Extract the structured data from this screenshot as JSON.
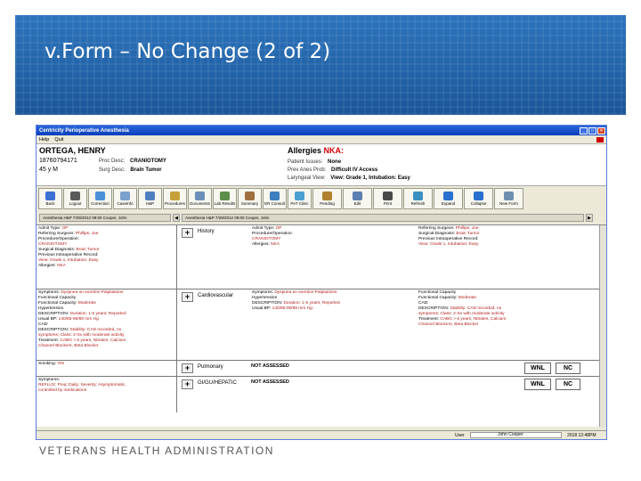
{
  "slide": {
    "title": "v.Form – No Change (2 of 2)",
    "footer": "VETERANS HEALTH ADMINISTRATION"
  },
  "app": {
    "window_title": "Centricity Perioperative Anesthesia",
    "menu": [
      "Help",
      "Quit"
    ],
    "patient": {
      "name": "ORTEGA, HENRY",
      "id": "18760794171",
      "age_sex": "45 y M",
      "proc_desc_label": "Proc Desc:",
      "proc_desc": "CRANIOTOMY",
      "surg_desc_label": "Surg Desc:",
      "surg_desc": "Brain Tumor",
      "allergies_label": "Allergies",
      "allergies_value": "NKA:",
      "patient_issues_label": "Patient Issues:",
      "patient_issues": "None",
      "prev_anes_label": "Prev Anes Prob:",
      "prev_anes": "Difficult IV Access",
      "laryngeal_label": "Laryngeal View:",
      "laryngeal": "View: Grade 1, Intubation: Easy"
    },
    "toolbar": [
      {
        "label": "Back",
        "color": "#3b6fd1"
      },
      {
        "label": "Logout",
        "color": "#5a5a5a"
      },
      {
        "label": "Correction",
        "color": "#4a8fd8"
      },
      {
        "label": "CaseInfo",
        "color": "#7aa0cc"
      },
      {
        "label": "H&P",
        "color": "#4f7fc0"
      },
      {
        "label": "Procedures",
        "color": "#c7a03a"
      },
      {
        "label": "Documents",
        "color": "#6c8fb8"
      },
      {
        "label": "Lab Results",
        "color": "#5b8f4a"
      },
      {
        "label": "Summary",
        "color": "#a07040"
      },
      {
        "label": "ER Consult",
        "color": "#3f7fbf"
      },
      {
        "label": "PAT Clinic",
        "color": "#4c9fd0"
      },
      {
        "label": "Pending",
        "color": "#b08030"
      },
      {
        "label": "Edit",
        "color": "#5a7fb0"
      },
      {
        "label": "Print",
        "color": "#4a4a4a"
      },
      {
        "label": "Refresh",
        "color": "#3a90c0"
      },
      {
        "label": "Expand",
        "color": "#2a70d0"
      },
      {
        "label": "Collapse",
        "color": "#2a70d0"
      },
      {
        "label": "New Form",
        "color": "#6f8fb0"
      }
    ],
    "tabs": {
      "left": "Anesthesia H&P 7/29/2012 09:00  Cooper, John",
      "right": "Anesthesia H&P 7/29/2012 09:00  Cooper, John"
    },
    "rows": {
      "history": {
        "label": "History",
        "left": [
          {
            "k": "Admit Type:",
            "v": "OP"
          },
          {
            "k": "Referring Surgeon:",
            "v": "Phillips, Joe"
          },
          {
            "k": "Procedure/Operation:",
            "v": ""
          },
          {
            "k": "",
            "v": "CRANIOTOMY"
          },
          {
            "k": "Surgical Diagnosis:",
            "v": "Brain Tumor"
          },
          {
            "k": "Previous Intraoperative Record:",
            "v": ""
          },
          {
            "k": "",
            "v": "View: Grade 1, Intubation: Easy"
          },
          {
            "k": "Allergies:",
            "v": "NKA"
          }
        ],
        "mid": [
          {
            "k": "Admit Type:",
            "v": "OP"
          },
          {
            "k": "Procedure/Operation:",
            "v": ""
          },
          {
            "k": "",
            "v": "CRANIOTOMY"
          },
          {
            "k": "Allergies:",
            "v": "NKA"
          }
        ],
        "right": [
          {
            "k": "Referring Surgeon:",
            "v": "Phillips, Joe"
          },
          {
            "k": "Surgical Diagnosis:",
            "v": "Brain Tumor"
          },
          {
            "k": "Previous Intraoperative Record:",
            "v": ""
          },
          {
            "k": "",
            "v": "View: Grade 1, Intubation: Easy"
          }
        ]
      },
      "cardio": {
        "label": "Cardiovascular",
        "left": [
          {
            "k": "Symptoms:",
            "v": "Dyspnea on exertion Palpitations"
          },
          {
            "k": "Functional Capacity",
            "v": ""
          },
          {
            "k": "Functional Capacity:",
            "v": "Moderate"
          },
          {
            "k": "Hypertension",
            "v": ""
          },
          {
            "k": "DESCRIPTION:",
            "v": "Duration: 1-5 years; Reported"
          },
          {
            "k": "Usual BP:",
            "v": "140/85-90/89 mm Hg"
          },
          {
            "k": "CAD:",
            "v": ""
          },
          {
            "k": "DESCRIPTION:",
            "v": "Stability: CAD recorded, no"
          },
          {
            "k": "",
            "v": "symptoms; Class: 2-Sx with moderate activity"
          },
          {
            "k": "Treatment:",
            "v": "CABG > 6 years, Nitrates, Calcium"
          },
          {
            "k": "",
            "v": "Channel Blockers, Beta Blocker"
          }
        ],
        "mid": [
          {
            "k": "Symptoms:",
            "v": "Dyspnea on exertion Palpitations"
          },
          {
            "k": "Hypertension",
            "v": ""
          },
          {
            "k": "DESCRIPTION:",
            "v": "Duration: 1-5 years; Reported"
          },
          {
            "k": "Usual BP:",
            "v": "140/85-90/89 mm Hg"
          }
        ],
        "right": [
          {
            "k": "Functional Capacity",
            "v": ""
          },
          {
            "k": "Functional Capacity:",
            "v": "Moderate"
          },
          {
            "k": "CAD:",
            "v": ""
          },
          {
            "k": "DESCRIPTION:",
            "v": "Stability: CAD recorded, no"
          },
          {
            "k": "",
            "v": "symptoms; Class: 2-Sx with moderate activity"
          },
          {
            "k": "Treatment:",
            "v": "CABG > 6 years, Nitrates, Calcium"
          },
          {
            "k": "",
            "v": "Channel Blockers, Beta Blocker"
          }
        ]
      },
      "pulmonary": {
        "label": "Pulmonary",
        "left": [
          {
            "k": "Smoking:",
            "v": "Yes"
          }
        ],
        "not_assessed": "NOT ASSESSED",
        "wnl": "WNL",
        "nc": "NC"
      },
      "gi": {
        "label": "GI/GU/HEPATIC",
        "left": [
          {
            "k": "Symptoms:",
            "v": ""
          },
          {
            "k": "",
            "v": "REFLUX: Freq: Daily; Severity: Asymptomatic,"
          },
          {
            "k": "",
            "v": "controlled by medications"
          }
        ],
        "not_assessed": "NOT ASSESSED",
        "wnl": "WNL",
        "nc": "NC"
      }
    },
    "status": {
      "user_label": "User",
      "user_value": "John Cooper",
      "datetime": "2018 12:48PM"
    }
  }
}
